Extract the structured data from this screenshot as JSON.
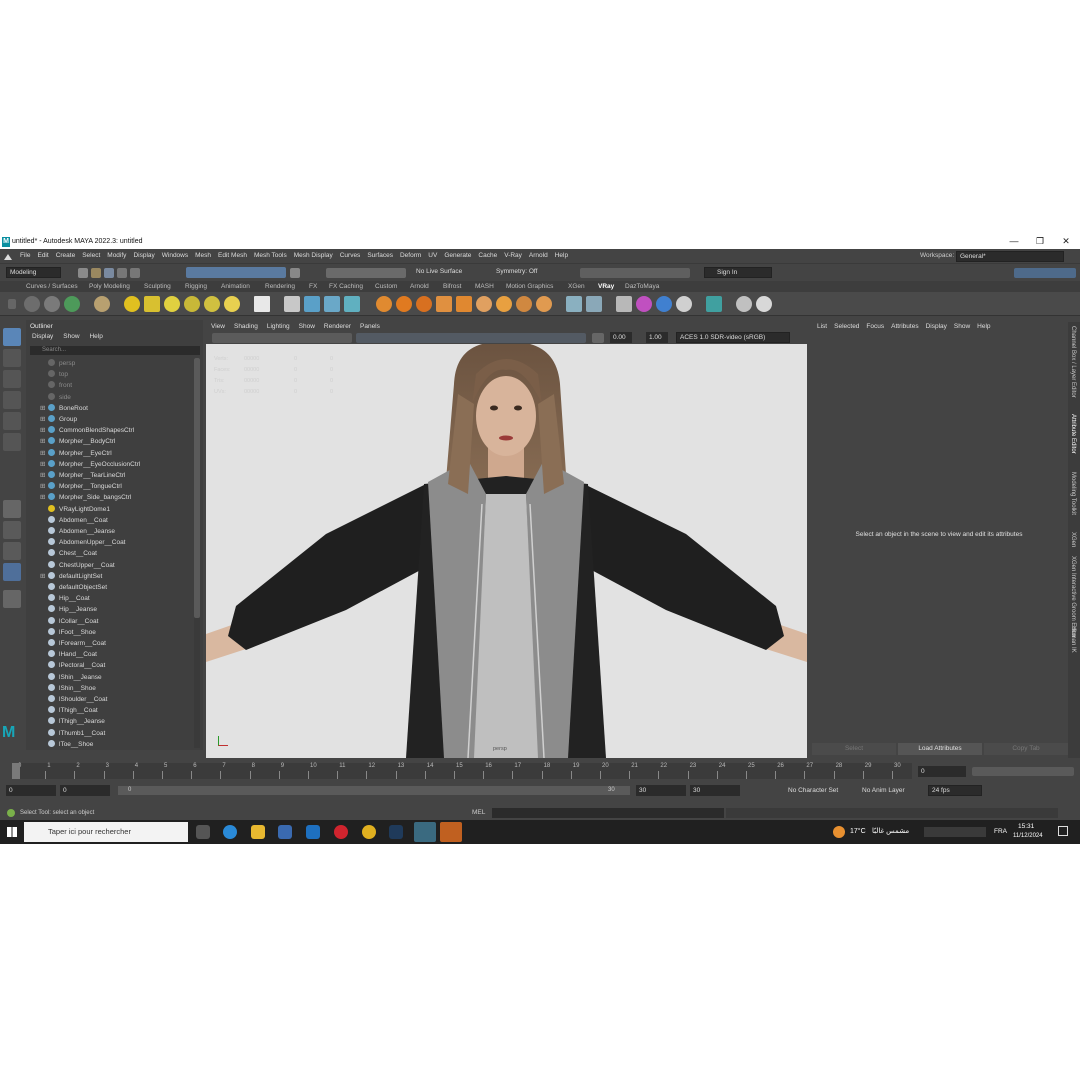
{
  "window": {
    "title": "untitled* - Autodesk MAYA 2022.3: untitled",
    "logo_letter": "M",
    "minimize": "—",
    "maximize": "❐",
    "close": "✕"
  },
  "menubar": {
    "items": [
      "File",
      "Edit",
      "Create",
      "Select",
      "Modify",
      "Display",
      "Windows",
      "Mesh",
      "Edit Mesh",
      "Mesh Tools",
      "Mesh Display",
      "Curves",
      "Surfaces",
      "Deform",
      "UV",
      "Generate",
      "Cache",
      "V-Ray",
      "Arnold",
      "Help"
    ],
    "workspace_label": "Workspace:",
    "workspace_value": "General*"
  },
  "statusline": {
    "mode": "Modeling",
    "live_surface": "No Live Surface",
    "symmetry": "Symmetry: Off",
    "sign_in": "Sign In"
  },
  "shelf": {
    "tabs": [
      "Curves / Surfaces",
      "Poly Modeling",
      "Sculpting",
      "Rigging",
      "Animation",
      "Rendering",
      "FX",
      "FX Caching",
      "Custom",
      "Arnold",
      "Bifrost",
      "MASH",
      "Motion Graphics",
      "XGen",
      "VRay",
      "DazToMaya"
    ],
    "active_tab": "VRay"
  },
  "outliner": {
    "title": "Outliner",
    "menu": [
      "Display",
      "Show",
      "Help"
    ],
    "search_placeholder": "Search...",
    "items": [
      {
        "label": "persp",
        "dim": true,
        "expand": ""
      },
      {
        "label": "top",
        "dim": true,
        "expand": ""
      },
      {
        "label": "front",
        "dim": true,
        "expand": ""
      },
      {
        "label": "side",
        "dim": true,
        "expand": ""
      },
      {
        "label": "BoneRoot",
        "dim": false,
        "expand": "⊞"
      },
      {
        "label": "Group",
        "dim": false,
        "expand": "⊞"
      },
      {
        "label": "CommonBlendShapesCtrl",
        "dim": false,
        "expand": "⊞"
      },
      {
        "label": "Morpher__BodyCtrl",
        "dim": false,
        "expand": "⊞"
      },
      {
        "label": "Morpher__EyeCtrl",
        "dim": false,
        "expand": "⊞"
      },
      {
        "label": "Morpher__EyeOcclusionCtrl",
        "dim": false,
        "expand": "⊞"
      },
      {
        "label": "Morpher__TearLineCtrl",
        "dim": false,
        "expand": "⊞"
      },
      {
        "label": "Morpher__TongueCtrl",
        "dim": false,
        "expand": "⊞"
      },
      {
        "label": "Morpher_Side_bangsCtrl",
        "dim": false,
        "expand": "⊞"
      },
      {
        "label": "VRayLightDome1",
        "dim": false,
        "expand": ""
      },
      {
        "label": "Abdomen__Coat",
        "dim": false,
        "expand": ""
      },
      {
        "label": "Abdomen__Jeanse",
        "dim": false,
        "expand": ""
      },
      {
        "label": "AbdomenUpper__Coat",
        "dim": false,
        "expand": ""
      },
      {
        "label": "Chest__Coat",
        "dim": false,
        "expand": ""
      },
      {
        "label": "ChestUpper__Coat",
        "dim": false,
        "expand": ""
      },
      {
        "label": "defaultLightSet",
        "dim": false,
        "expand": "⊞"
      },
      {
        "label": "defaultObjectSet",
        "dim": false,
        "expand": ""
      },
      {
        "label": "Hip__Coat",
        "dim": false,
        "expand": ""
      },
      {
        "label": "Hip__Jeanse",
        "dim": false,
        "expand": ""
      },
      {
        "label": "lCollar__Coat",
        "dim": false,
        "expand": ""
      },
      {
        "label": "lFoot__Shoe",
        "dim": false,
        "expand": ""
      },
      {
        "label": "lForearm__Coat",
        "dim": false,
        "expand": ""
      },
      {
        "label": "lHand__Coat",
        "dim": false,
        "expand": ""
      },
      {
        "label": "lPectoral__Coat",
        "dim": false,
        "expand": ""
      },
      {
        "label": "lShin__Jeanse",
        "dim": false,
        "expand": ""
      },
      {
        "label": "lShin__Shoe",
        "dim": false,
        "expand": ""
      },
      {
        "label": "lShoulder__Coat",
        "dim": false,
        "expand": ""
      },
      {
        "label": "lThigh__Coat",
        "dim": false,
        "expand": ""
      },
      {
        "label": "lThigh__Jeanse",
        "dim": false,
        "expand": ""
      },
      {
        "label": "lThumb1__Coat",
        "dim": false,
        "expand": ""
      },
      {
        "label": "lToe__Shoe",
        "dim": false,
        "expand": ""
      }
    ]
  },
  "viewport": {
    "menu": [
      "View",
      "Shading",
      "Lighting",
      "Show",
      "Renderer",
      "Panels"
    ],
    "exposure": "0.00",
    "gamma": "1.00",
    "colorspace": "ACES 1.0 SDR-video (sRGB)",
    "camera_label": "persp",
    "hud_rows": [
      [
        "Verts:",
        "00000",
        "0",
        "0"
      ],
      [
        "Faces:",
        "00000",
        "0",
        "0"
      ],
      [
        "Tris:",
        "00000",
        "0",
        "0"
      ],
      [
        "UVs:",
        "00000",
        "0",
        "0"
      ]
    ]
  },
  "attribute_editor": {
    "menu": [
      "List",
      "Selected",
      "Focus",
      "Attributes",
      "Display",
      "Show",
      "Help"
    ],
    "message": "Select an object in the scene to view and edit its attributes",
    "buttons": [
      "Select",
      "Load Attributes",
      "Copy Tab"
    ]
  },
  "side_tabs": [
    "Channel Box / Layer Editor",
    "Attribute Editor",
    "Modeling Toolkit",
    "XGen",
    "XGen Interactive Groom Editor",
    "Human IK"
  ],
  "timeline": {
    "ticks": [
      "0",
      "1",
      "2",
      "3",
      "4",
      "5",
      "6",
      "7",
      "8",
      "9",
      "10",
      "11",
      "12",
      "13",
      "14",
      "15",
      "16",
      "17",
      "18",
      "19",
      "20",
      "21",
      "22",
      "23",
      "24",
      "25",
      "26",
      "27",
      "28",
      "29",
      "30"
    ],
    "current_frame": "0"
  },
  "range": {
    "start": "0",
    "start_inner": "0",
    "slider_start": "0",
    "slider_end": "30",
    "end_inner": "30",
    "end": "30",
    "character_set": "No Character Set",
    "anim_layer": "No Anim Layer",
    "fps": "24 fps"
  },
  "helpline": {
    "text": "Select Tool: select an object",
    "mel": "MEL"
  },
  "taskbar": {
    "search_placeholder": "Taper ici pour rechercher",
    "weather": "17°C",
    "weather_desc": "مشمس غالبًا",
    "lang": "FRA",
    "time": "15:31",
    "date": "11/12/2024"
  }
}
